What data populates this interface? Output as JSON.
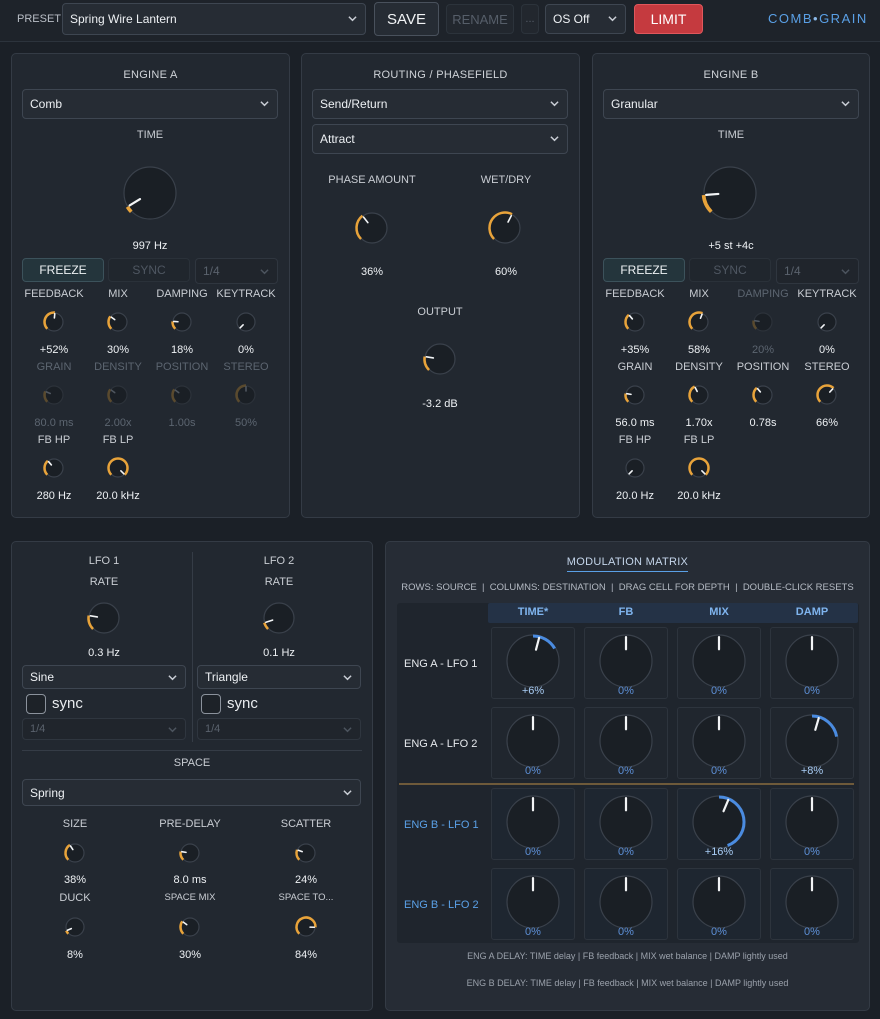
{
  "topbar": {
    "preset_label": "PRESET",
    "preset_value": "Spring Wire Lantern",
    "save_label": "SAVE",
    "rename_label": "RENAME",
    "more_label": "...",
    "os_value": "OS Off",
    "limit_label": "LIMIT",
    "brand": {
      "left": "COMB",
      "dot": "•",
      "right": "GRAIN"
    }
  },
  "colors": {
    "accent": "#e8a33a",
    "limit": "#c53a3f",
    "brand": "#5aa0e6",
    "mod": "#4a8be0"
  },
  "engine_a": {
    "title": "ENGINE A",
    "type": "Comb",
    "time_label": "TIME",
    "time_value": "997 Hz",
    "time_level": 0.05,
    "freeze_label": "FREEZE",
    "sync_label": "SYNC",
    "division": "1/4",
    "knobs": [
      {
        "label": "FEEDBACK",
        "value": "+52%",
        "level": 0.52
      },
      {
        "label": "MIX",
        "value": "30%",
        "level": 0.3
      },
      {
        "label": "DAMPING",
        "value": "18%",
        "level": 0.18
      },
      {
        "label": "KEYTRACK",
        "value": "0%",
        "level": 0.0
      },
      {
        "label": "GRAIN",
        "value": "80.0 ms",
        "level": 0.25
      },
      {
        "label": "DENSITY",
        "value": "2.00x",
        "level": 0.3
      },
      {
        "label": "POSITION",
        "value": "1.00s",
        "level": 0.3
      },
      {
        "label": "STEREO",
        "value": "50%",
        "level": 0.5
      },
      {
        "label": "FB HP",
        "value": "280 Hz",
        "level": 0.35
      },
      {
        "label": "FB LP",
        "value": "20.0 kHz",
        "level": 1.0
      }
    ]
  },
  "routing": {
    "title": "ROUTING / PHASEFIELD",
    "mode": "Send/Return",
    "phase_mode": "Attract",
    "phase_amount": {
      "label": "PHASE AMOUNT",
      "value": "36%",
      "level": 0.36
    },
    "wet_dry": {
      "label": "WET/DRY",
      "value": "60%",
      "level": 0.6
    },
    "output": {
      "label": "OUTPUT",
      "value": "-3.2 dB",
      "level": 0.2
    }
  },
  "engine_b": {
    "title": "ENGINE B",
    "type": "Granular",
    "time_label": "TIME",
    "time_value": "+5 st +4c",
    "time_level": 0.15,
    "freeze_label": "FREEZE",
    "sync_label": "SYNC",
    "division": "1/4",
    "knobs": [
      {
        "label": "FEEDBACK",
        "value": "+35%",
        "level": 0.35
      },
      {
        "label": "MIX",
        "value": "58%",
        "level": 0.58
      },
      {
        "label": "DAMPING",
        "value": "20%",
        "level": 0.2
      },
      {
        "label": "KEYTRACK",
        "value": "0%",
        "level": 0.0
      },
      {
        "label": "GRAIN",
        "value": "56.0 ms",
        "level": 0.2
      },
      {
        "label": "DENSITY",
        "value": "1.70x",
        "level": 0.4
      },
      {
        "label": "POSITION",
        "value": "0.78s",
        "level": 0.35
      },
      {
        "label": "STEREO",
        "value": "66%",
        "level": 0.66
      },
      {
        "label": "FB HP",
        "value": "20.0 Hz",
        "level": 0.0
      },
      {
        "label": "FB LP",
        "value": "20.0 kHz",
        "level": 1.0
      }
    ]
  },
  "lfo1": {
    "title": "LFO 1",
    "rate_label": "RATE",
    "rate_value": "0.3 Hz",
    "level": 0.2,
    "shape": "Sine",
    "sync_label": "sync",
    "division": "1/4"
  },
  "lfo2": {
    "title": "LFO 2",
    "rate_label": "RATE",
    "rate_value": "0.1 Hz",
    "level": 0.1,
    "shape": "Triangle",
    "sync_label": "sync",
    "division": "1/4"
  },
  "space": {
    "title": "SPACE",
    "type": "Spring",
    "knobs": [
      {
        "label": "SIZE",
        "value": "38%",
        "level": 0.38
      },
      {
        "label": "PRE-DELAY",
        "value": "8.0 ms",
        "level": 0.2
      },
      {
        "label": "SCATTER",
        "value": "24%",
        "level": 0.24
      },
      {
        "label": "DUCK",
        "value": "8%",
        "level": 0.08
      },
      {
        "label": "SPACE MIX",
        "value": "30%",
        "level": 0.3
      },
      {
        "label": "SPACE TO...",
        "value": "84%",
        "level": 0.84
      }
    ]
  },
  "matrix": {
    "title": "MODULATION MATRIX",
    "help": "ROWS: SOURCE  |  COLUMNS: DESTINATION  |  DRAG CELL FOR DEPTH  |  DOUBLE-CLICK RESETS",
    "columns": [
      "TIME*",
      "FB",
      "MIX",
      "DAMP"
    ],
    "rows": [
      {
        "label": "ENG A - LFO 1",
        "values": [
          "+6%",
          "0%",
          "0%",
          "0%"
        ],
        "depths": [
          0.06,
          0,
          0,
          0
        ]
      },
      {
        "label": "ENG A - LFO 2",
        "values": [
          "0%",
          "0%",
          "0%",
          "+8%"
        ],
        "depths": [
          0,
          0,
          0,
          0.08
        ]
      },
      {
        "label": "ENG B - LFO 1",
        "values": [
          "0%",
          "0%",
          "+16%",
          "0%"
        ],
        "depths": [
          0,
          0,
          0.16,
          0
        ]
      },
      {
        "label": "ENG B - LFO 2",
        "values": [
          "0%",
          "0%",
          "0%",
          "0%"
        ],
        "depths": [
          0,
          0,
          0,
          0
        ]
      }
    ],
    "footer_a": "ENG A DELAY: TIME delay | FB feedback | MIX wet balance | DAMP lightly used",
    "footer_b": "ENG B DELAY: TIME delay | FB feedback | MIX wet balance | DAMP lightly used"
  }
}
